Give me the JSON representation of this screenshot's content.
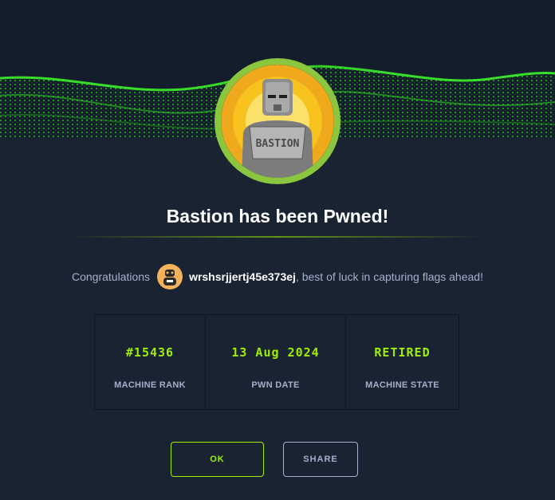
{
  "dialog": {
    "title": "Bastion has been Pwned!",
    "congrats_prefix": "Congratulations",
    "username": "wrshsrjjertj45e373ej",
    "congrats_suffix": ", best of luck in capturing flags ahead!",
    "machine_logo_text": "BASTION"
  },
  "stats": [
    {
      "value": "#15436",
      "label": "MACHINE RANK"
    },
    {
      "value": "13 Aug 2024",
      "label": "PWN DATE"
    },
    {
      "value": "RETIRED",
      "label": "MACHINE STATE"
    }
  ],
  "buttons": {
    "ok": "OK",
    "share": "SHARE"
  },
  "colors": {
    "accent": "#9fef00",
    "background": "#1a2332",
    "banner": "#141d2b",
    "ring": "#8ac73e",
    "muted_text": "#a4b1cd"
  },
  "icons": {
    "machine_avatar": "bastion-robot-avatar",
    "user_avatar": "user-avatar-icon"
  }
}
